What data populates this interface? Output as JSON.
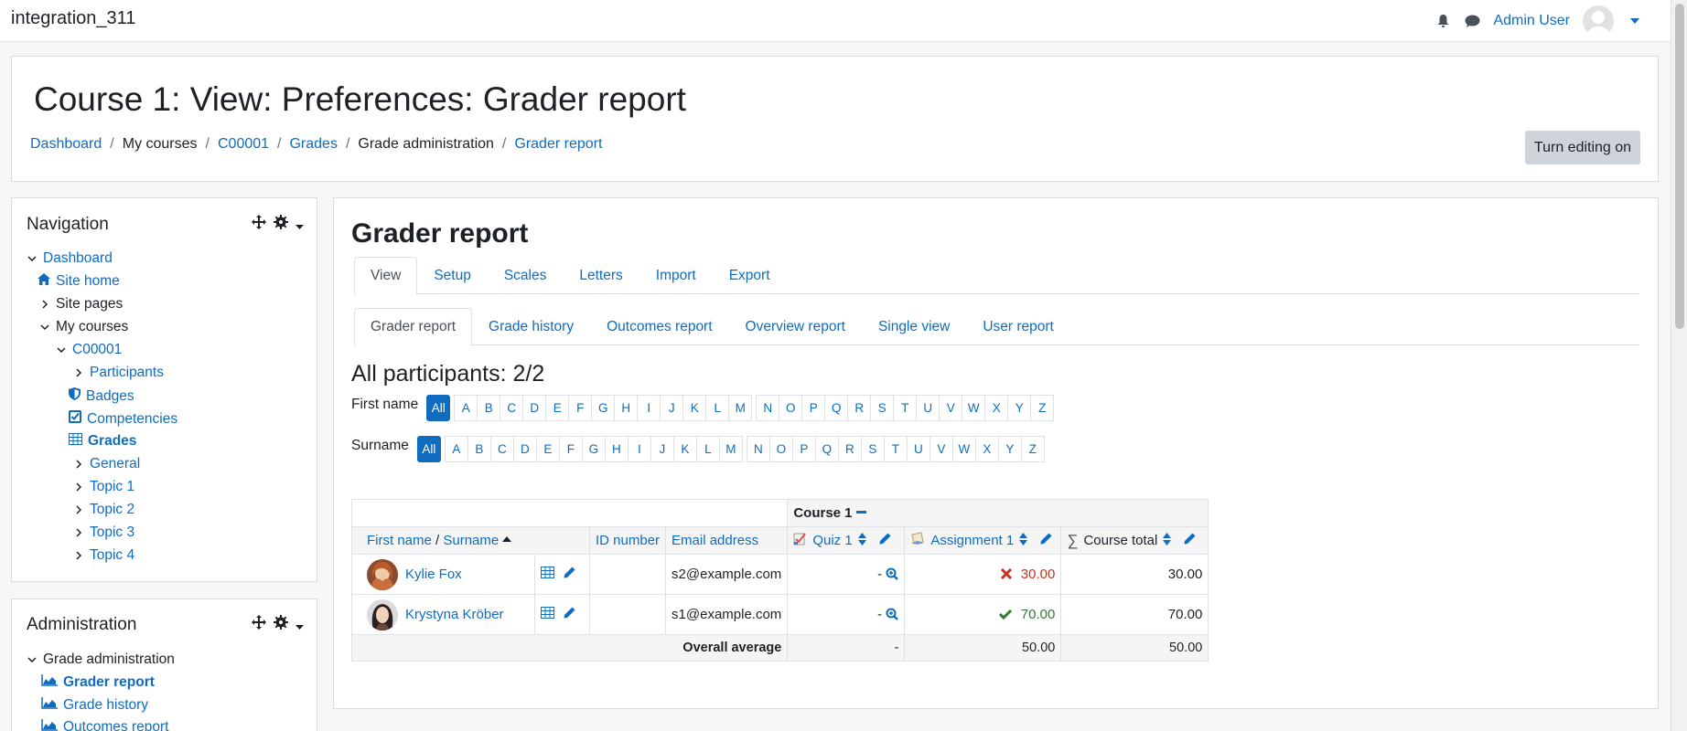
{
  "site": {
    "brand": "integration_311",
    "username": "Admin User"
  },
  "header": {
    "title": "Course 1: View: Preferences: Grader report",
    "breadcrumb": [
      "Dashboard",
      "My courses",
      "C00001",
      "Grades",
      "Grade administration",
      "Grader report"
    ],
    "edit_button": "Turn editing on"
  },
  "navigation": {
    "title": "Navigation",
    "items": [
      "Dashboard",
      "Site home",
      "Site pages",
      "My courses",
      "C00001",
      "Participants",
      "Badges",
      "Competencies",
      "Grades",
      "General",
      "Topic 1",
      "Topic 2",
      "Topic 3",
      "Topic 4"
    ]
  },
  "administration": {
    "title": "Administration",
    "items": [
      "Grade administration",
      "Grader report",
      "Grade history",
      "Outcomes report"
    ]
  },
  "report": {
    "title": "Grader report",
    "tabs": [
      "View",
      "Setup",
      "Scales",
      "Letters",
      "Import",
      "Export"
    ],
    "subtabs": [
      "Grader report",
      "Grade history",
      "Outcomes report",
      "Overview report",
      "Single view",
      "User report"
    ],
    "participants": "All participants: 2/2",
    "firstname_label": "First name",
    "surname_label": "Surname",
    "letters_all": "All",
    "letters_a_m": [
      "A",
      "B",
      "C",
      "D",
      "E",
      "F",
      "G",
      "H",
      "I",
      "J",
      "K",
      "L",
      "M"
    ],
    "letters_n_z": [
      "N",
      "O",
      "P",
      "Q",
      "R",
      "S",
      "T",
      "U",
      "V",
      "W",
      "X",
      "Y",
      "Z"
    ]
  },
  "table": {
    "course_header": "Course 1",
    "col_firstname": "First name",
    "col_slash": " / ",
    "col_surname": "Surname",
    "col_id": "ID number",
    "col_email": "Email address",
    "col_quiz": "Quiz 1",
    "col_assignment": "Assignment 1",
    "col_total": "Course total",
    "rows": [
      {
        "name": "Kylie Fox",
        "email": "s2@example.com",
        "quiz": "-",
        "assignment": "30.00",
        "total": "30.00"
      },
      {
        "name": "Krystyna Kröber",
        "email": "s1@example.com",
        "quiz": "-",
        "assignment": "70.00",
        "total": "70.00"
      }
    ],
    "average_label": "Overall average",
    "average_quiz": "-",
    "average_assignment": "50.00",
    "average_total": "50.00"
  },
  "colors": {
    "link": "#0f6cbf",
    "fail": "#ca3120",
    "pass": "#357a32"
  }
}
